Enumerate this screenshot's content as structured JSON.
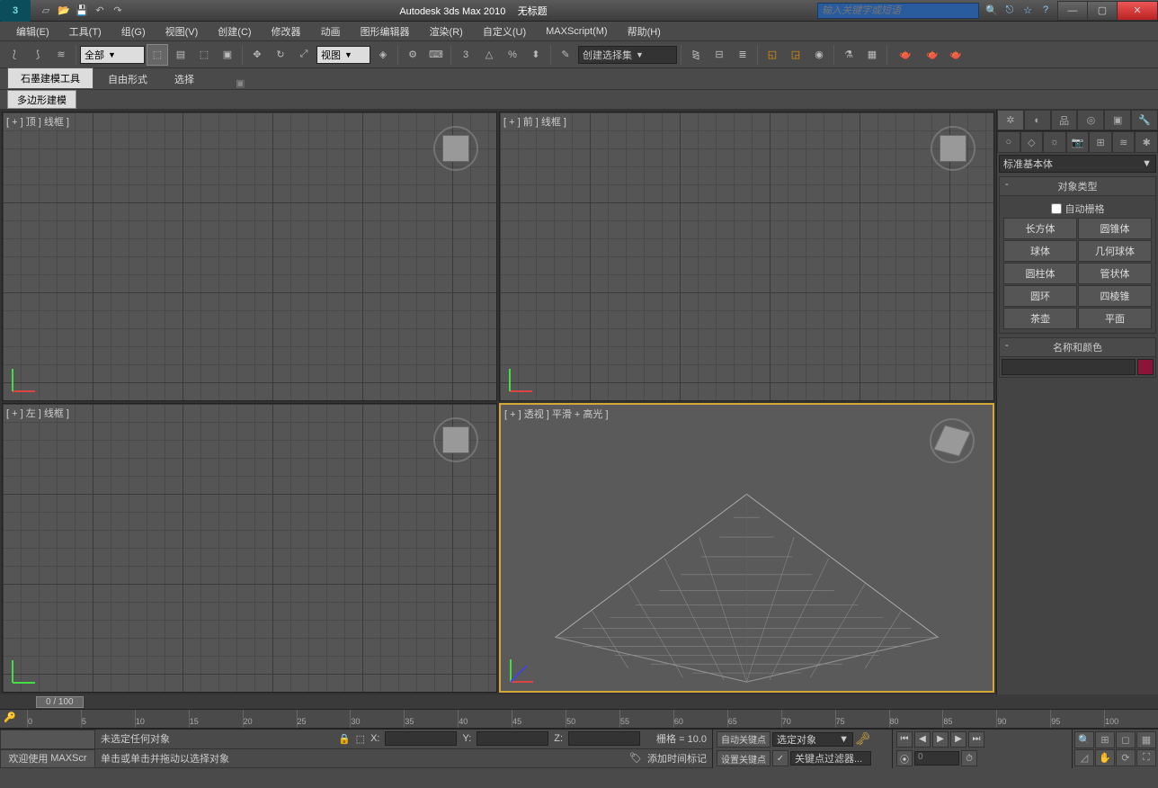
{
  "title": {
    "app": "Autodesk 3ds Max  2010",
    "doc": "无标题"
  },
  "search": {
    "placeholder": "输入关键字或短语"
  },
  "menu": [
    "编辑(E)",
    "工具(T)",
    "组(G)",
    "视图(V)",
    "创建(C)",
    "修改器",
    "动画",
    "图形编辑器",
    "渲染(R)",
    "自定义(U)",
    "MAXScript(M)",
    "帮助(H)"
  ],
  "toolbar": {
    "filter_combo": "全部",
    "coord_combo": "视图",
    "selset_combo": "创建选择集"
  },
  "ribbon": {
    "tabs": [
      "石墨建模工具",
      "自由形式",
      "选择"
    ],
    "sub": "多边形建模"
  },
  "viewports": {
    "top": "[ + ] 顶 ] 线框 ]",
    "front": "[ + ] 前 ] 线框 ]",
    "left": "[ + ] 左 ] 线框 ]",
    "persp": "[ + ] 透视 ] 平滑 + 高光 ]"
  },
  "cmd": {
    "category": "标准基本体",
    "rollout_type": "对象类型",
    "auto_grid": "自动栅格",
    "objects": [
      "长方体",
      "圆锥体",
      "球体",
      "几何球体",
      "圆柱体",
      "管状体",
      "圆环",
      "四棱锥",
      "茶壶",
      "平面"
    ],
    "rollout_name": "名称和颜色"
  },
  "timeline": {
    "pos": "0 / 100",
    "ticks": [
      "0",
      "5",
      "10",
      "15",
      "20",
      "25",
      "30",
      "35",
      "40",
      "45",
      "50",
      "55",
      "60",
      "65",
      "70",
      "75",
      "80",
      "85",
      "90",
      "95",
      "100"
    ]
  },
  "status": {
    "welcome": "欢迎使用",
    "script": "MAXScr",
    "none_selected": "未选定任何对象",
    "hint": "单击或单击并拖动以选择对象",
    "x": "X:",
    "y": "Y:",
    "z": "Z:",
    "grid": "栅格 = 10.0",
    "add_marker": "添加时间标记",
    "auto_key": "自动关键点",
    "set_key": "设置关键点",
    "sel_obj": "选定对象",
    "key_filter": "关键点过滤器...",
    "frame": "0"
  }
}
